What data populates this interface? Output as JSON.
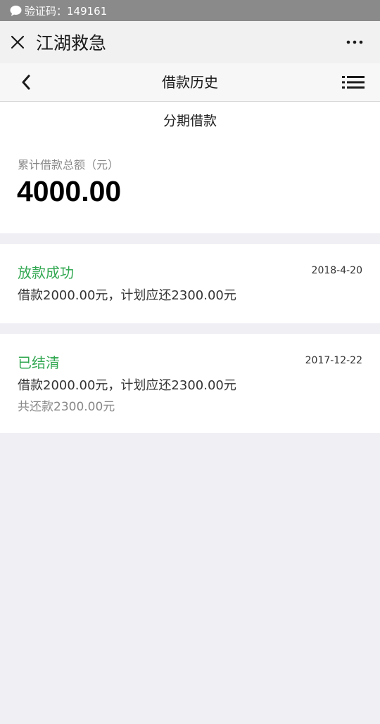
{
  "notification": {
    "text": "验证码：149161",
    "icon": "chat-bubble-icon"
  },
  "title_bar": {
    "title": "江湖救急",
    "close_icon": "close-icon",
    "more_icon": "more-dots-icon"
  },
  "nav_bar": {
    "title": "借款历史",
    "back_icon": "chevron-left-icon",
    "menu_icon": "list-menu-icon"
  },
  "summary": {
    "title": "分期借款",
    "label": "累计借款总额（元）",
    "amount": "4000.00"
  },
  "records": [
    {
      "status": "放款成功",
      "date": "2018-4-20",
      "detail": "借款2000.00元，计划应还2300.00元",
      "repaid": ""
    },
    {
      "status": "已结清",
      "date": "2017-12-22",
      "detail": "借款2000.00元，计划应还2300.00元",
      "repaid": "共还款2300.00元"
    }
  ],
  "colors": {
    "status_green": "#33a852",
    "background": "#efeff4",
    "notification_bg": "#8a8a8a"
  }
}
